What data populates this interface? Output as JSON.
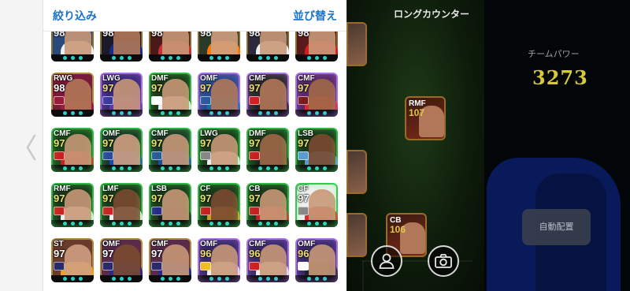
{
  "panel": {
    "filter_label": "絞り込み",
    "sort_label": "並び替え",
    "cards_partial": [
      {
        "ovr": "98",
        "frame": "#8c6a2a",
        "bg": "#2a4a7a",
        "face": "#c89878",
        "shirt": "#f0f0f0",
        "badge": "#2a4a9a",
        "oc": "#f0f0f0"
      },
      {
        "ovr": "98",
        "frame": "#8c6a2a",
        "bg": "#1a1a2a",
        "face": "#b07858",
        "shirt": "#1a2a8a",
        "badge": "#2a2a6a",
        "oc": "#f0f0f0"
      },
      {
        "ovr": "98",
        "frame": "#8c6a2a",
        "bg": "#4a1a1a",
        "face": "#c89878",
        "shirt": "#c83030",
        "badge": "#eeeeee",
        "oc": "#f0f0f0"
      },
      {
        "ovr": "98",
        "frame": "#8c6a2a",
        "bg": "#2a3a2a",
        "face": "#d0a080",
        "shirt": "#ff7a00",
        "badge": "#cc2222",
        "oc": "#f0f0f0"
      },
      {
        "ovr": "98",
        "frame": "#8c6a2a",
        "bg": "#2a2a3a",
        "face": "#c89878",
        "shirt": "#eeeeee",
        "badge": "#888888",
        "oc": "#f0f0f0"
      },
      {
        "ovr": "98",
        "frame": "#8c6a2a",
        "bg": "#5a1a1a",
        "face": "#c89878",
        "shirt": "#d02020",
        "badge": "#cc2222",
        "oc": "#f0f0f0"
      }
    ],
    "cards": [
      {
        "pos": "RWG",
        "ovr": "98",
        "frame": "#b08a3a",
        "bg": "#7a1a3a",
        "face": "#b07858",
        "shirt": "#9a1a3a",
        "badge": "#9a1a3a",
        "oc": "#ffffff",
        "fx": "none"
      },
      {
        "pos": "LWG",
        "ovr": "97",
        "frame": "#a070d8",
        "bg": "#3a2a7a",
        "face": "#c89878",
        "shirt": "#5a3aa8",
        "badge": "#3a3a9a",
        "oc": "#f0e070",
        "fx": "purple"
      },
      {
        "pos": "DMF",
        "ovr": "97",
        "frame": "#2a9a3a",
        "bg": "#1a3a1a",
        "face": "#c89878",
        "shirt": "#eeeeee",
        "badge": "#ffffff",
        "oc": "#f0e070",
        "fx": "green"
      },
      {
        "pos": "OMF",
        "ovr": "97",
        "frame": "#a070d8",
        "bg": "#2a4a8a",
        "face": "#b07858",
        "shirt": "#1a6aa8",
        "badge": "#2a5a9a",
        "oc": "#f0e070",
        "fx": "purple"
      },
      {
        "pos": "CMF",
        "ovr": "97",
        "frame": "#a070d8",
        "bg": "#2a2a2a",
        "face": "#b07858",
        "shirt": "#222222",
        "badge": "#d02020",
        "oc": "#f0e070",
        "fx": "purple"
      },
      {
        "pos": "CMF",
        "ovr": "97",
        "frame": "#a070d8",
        "bg": "#5a2a6a",
        "face": "#a06848",
        "shirt": "#e02a2a",
        "badge": "#7a1a1a",
        "oc": "#f0e070",
        "fx": "purple"
      },
      {
        "pos": "CMF",
        "ovr": "97",
        "frame": "#2a9a3a",
        "bg": "#1a4a1a",
        "face": "#c89878",
        "shirt": "#c82020",
        "badge": "#c82020",
        "oc": "#f0e070",
        "fx": "green"
      },
      {
        "pos": "OMF",
        "ovr": "97",
        "frame": "#2a9a3a",
        "bg": "#1a3a2a",
        "face": "#d0a080",
        "shirt": "#1a4aa8",
        "badge": "#2a4a9a",
        "oc": "#f0e070",
        "fx": "green"
      },
      {
        "pos": "CMF",
        "ovr": "97",
        "frame": "#2a9a3a",
        "bg": "#1a3a2a",
        "face": "#c89878",
        "shirt": "#1a4aa8",
        "badge": "#2a5a9a",
        "oc": "#f0e070",
        "fx": "green"
      },
      {
        "pos": "LWG",
        "ovr": "97",
        "frame": "#2a9a3a",
        "bg": "#1a3a1a",
        "face": "#c89878",
        "shirt": "#eeeeee",
        "badge": "#888888",
        "oc": "#f0e070",
        "fx": "green"
      },
      {
        "pos": "DMF",
        "ovr": "97",
        "frame": "#2a9a3a",
        "bg": "#1a3a1a",
        "face": "#a06848",
        "shirt": "#222222",
        "badge": "#c82020",
        "oc": "#f0e070",
        "fx": "green"
      },
      {
        "pos": "LSB",
        "ovr": "97",
        "frame": "#2a9a3a",
        "bg": "#1a3a1a",
        "face": "#7a4a30",
        "shirt": "#5a9ad0",
        "badge": "#5a9ad0",
        "oc": "#f0e070",
        "fx": "green"
      },
      {
        "pos": "RMF",
        "ovr": "97",
        "frame": "#2a9a3a",
        "bg": "#1a3a1a",
        "face": "#c89878",
        "shirt": "#eeeeee",
        "badge": "#cc2222",
        "oc": "#f0e070",
        "fx": "green"
      },
      {
        "pos": "LMF",
        "ovr": "97",
        "frame": "#2a9a3a",
        "bg": "#1a3a1a",
        "face": "#7a4a30",
        "shirt": "#eeeeee",
        "badge": "#cc2222",
        "oc": "#f0e070",
        "fx": "green"
      },
      {
        "pos": "LSB",
        "ovr": "97",
        "frame": "#2a9a3a",
        "bg": "#1a3a1a",
        "face": "#c89878",
        "shirt": "#1a1a1a",
        "badge": "#2a2a8a",
        "oc": "#f0e070",
        "fx": "green"
      },
      {
        "pos": "CF",
        "ovr": "97",
        "frame": "#2a9a3a",
        "bg": "#1a3a1a",
        "face": "#7a4a30",
        "shirt": "#c8a020",
        "badge": "#c82020",
        "oc": "#f0e070",
        "fx": "green"
      },
      {
        "pos": "CB",
        "ovr": "97",
        "frame": "#2a9a3a",
        "bg": "#1a3a1a",
        "face": "#c89878",
        "shirt": "#c82020",
        "badge": "#c82020",
        "oc": "#f0e070",
        "fx": "green"
      },
      {
        "pos": "CF",
        "ovr": "97",
        "frame": "#2ab84a",
        "bg": "#f0f0f0",
        "face": "#c89878",
        "shirt": "#e02a2a",
        "badge": "#888888",
        "oc": "#ffffff",
        "fx": "green"
      },
      {
        "pos": "ST",
        "ovr": "97",
        "frame": "#b08a3a",
        "bg": "#6a3a2a",
        "face": "#d0a080",
        "shirt": "#f0a020",
        "badge": "#2a2a6a",
        "oc": "#ffffff",
        "fx": "none"
      },
      {
        "pos": "OMF",
        "ovr": "97",
        "frame": "#b08a3a",
        "bg": "#5a2a4a",
        "face": "#7a4a30",
        "shirt": "#2a2a8a",
        "badge": "#2a2a6a",
        "oc": "#ffffff",
        "fx": "none"
      },
      {
        "pos": "CMF",
        "ovr": "97",
        "frame": "#b08a3a",
        "bg": "#5a2a4a",
        "face": "#c89878",
        "shirt": "#2a2a8a",
        "badge": "#2a2a6a",
        "oc": "#ffffff",
        "fx": "none"
      },
      {
        "pos": "OMF",
        "ovr": "96",
        "frame": "#a070d8",
        "bg": "#3a2a6a",
        "face": "#c89878",
        "shirt": "#eeeeee",
        "badge": "#f0c020",
        "oc": "#f0e070",
        "fx": "purple"
      },
      {
        "pos": "CMF",
        "ovr": "96",
        "frame": "#a070d8",
        "bg": "#3a2a6a",
        "face": "#c89878",
        "shirt": "#eeeeee",
        "badge": "#cc2222",
        "oc": "#f0e070",
        "fx": "purple"
      },
      {
        "pos": "OMF",
        "ovr": "96",
        "frame": "#a070d8",
        "bg": "#3a2a6a",
        "face": "#c89878",
        "shirt": "#222222",
        "badge": "#ffffff",
        "oc": "#f0e070",
        "fx": "purple"
      }
    ]
  },
  "pitch": {
    "formation_label": "ロングカウンター",
    "team_power_label": "チームパワー",
    "team_power_value": "3273",
    "auto_button_label": "自動配置",
    "rmf_card": {
      "pos": "RMF",
      "ovr": "107"
    },
    "cb_card": {
      "pos": "CB",
      "ovr": "106"
    }
  }
}
